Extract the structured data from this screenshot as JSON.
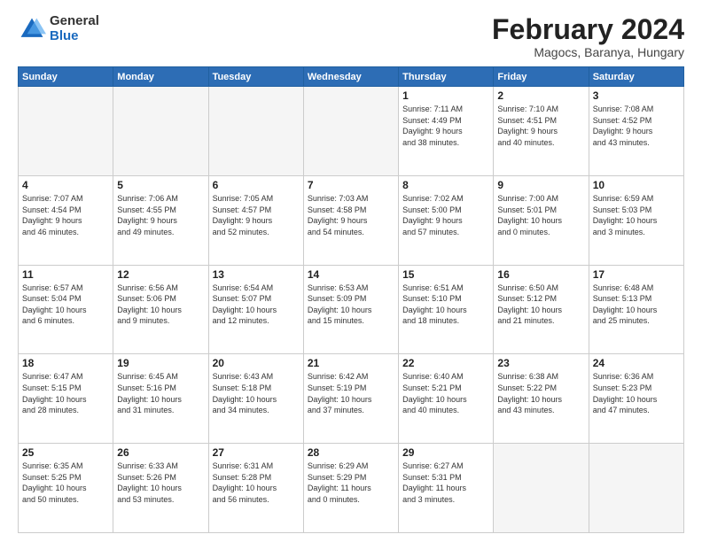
{
  "logo": {
    "general": "General",
    "blue": "Blue"
  },
  "header": {
    "title": "February 2024",
    "subtitle": "Magocs, Baranya, Hungary"
  },
  "columns": [
    "Sunday",
    "Monday",
    "Tuesday",
    "Wednesday",
    "Thursday",
    "Friday",
    "Saturday"
  ],
  "weeks": [
    [
      {
        "day": "",
        "info": ""
      },
      {
        "day": "",
        "info": ""
      },
      {
        "day": "",
        "info": ""
      },
      {
        "day": "",
        "info": ""
      },
      {
        "day": "1",
        "info": "Sunrise: 7:11 AM\nSunset: 4:49 PM\nDaylight: 9 hours\nand 38 minutes."
      },
      {
        "day": "2",
        "info": "Sunrise: 7:10 AM\nSunset: 4:51 PM\nDaylight: 9 hours\nand 40 minutes."
      },
      {
        "day": "3",
        "info": "Sunrise: 7:08 AM\nSunset: 4:52 PM\nDaylight: 9 hours\nand 43 minutes."
      }
    ],
    [
      {
        "day": "4",
        "info": "Sunrise: 7:07 AM\nSunset: 4:54 PM\nDaylight: 9 hours\nand 46 minutes."
      },
      {
        "day": "5",
        "info": "Sunrise: 7:06 AM\nSunset: 4:55 PM\nDaylight: 9 hours\nand 49 minutes."
      },
      {
        "day": "6",
        "info": "Sunrise: 7:05 AM\nSunset: 4:57 PM\nDaylight: 9 hours\nand 52 minutes."
      },
      {
        "day": "7",
        "info": "Sunrise: 7:03 AM\nSunset: 4:58 PM\nDaylight: 9 hours\nand 54 minutes."
      },
      {
        "day": "8",
        "info": "Sunrise: 7:02 AM\nSunset: 5:00 PM\nDaylight: 9 hours\nand 57 minutes."
      },
      {
        "day": "9",
        "info": "Sunrise: 7:00 AM\nSunset: 5:01 PM\nDaylight: 10 hours\nand 0 minutes."
      },
      {
        "day": "10",
        "info": "Sunrise: 6:59 AM\nSunset: 5:03 PM\nDaylight: 10 hours\nand 3 minutes."
      }
    ],
    [
      {
        "day": "11",
        "info": "Sunrise: 6:57 AM\nSunset: 5:04 PM\nDaylight: 10 hours\nand 6 minutes."
      },
      {
        "day": "12",
        "info": "Sunrise: 6:56 AM\nSunset: 5:06 PM\nDaylight: 10 hours\nand 9 minutes."
      },
      {
        "day": "13",
        "info": "Sunrise: 6:54 AM\nSunset: 5:07 PM\nDaylight: 10 hours\nand 12 minutes."
      },
      {
        "day": "14",
        "info": "Sunrise: 6:53 AM\nSunset: 5:09 PM\nDaylight: 10 hours\nand 15 minutes."
      },
      {
        "day": "15",
        "info": "Sunrise: 6:51 AM\nSunset: 5:10 PM\nDaylight: 10 hours\nand 18 minutes."
      },
      {
        "day": "16",
        "info": "Sunrise: 6:50 AM\nSunset: 5:12 PM\nDaylight: 10 hours\nand 21 minutes."
      },
      {
        "day": "17",
        "info": "Sunrise: 6:48 AM\nSunset: 5:13 PM\nDaylight: 10 hours\nand 25 minutes."
      }
    ],
    [
      {
        "day": "18",
        "info": "Sunrise: 6:47 AM\nSunset: 5:15 PM\nDaylight: 10 hours\nand 28 minutes."
      },
      {
        "day": "19",
        "info": "Sunrise: 6:45 AM\nSunset: 5:16 PM\nDaylight: 10 hours\nand 31 minutes."
      },
      {
        "day": "20",
        "info": "Sunrise: 6:43 AM\nSunset: 5:18 PM\nDaylight: 10 hours\nand 34 minutes."
      },
      {
        "day": "21",
        "info": "Sunrise: 6:42 AM\nSunset: 5:19 PM\nDaylight: 10 hours\nand 37 minutes."
      },
      {
        "day": "22",
        "info": "Sunrise: 6:40 AM\nSunset: 5:21 PM\nDaylight: 10 hours\nand 40 minutes."
      },
      {
        "day": "23",
        "info": "Sunrise: 6:38 AM\nSunset: 5:22 PM\nDaylight: 10 hours\nand 43 minutes."
      },
      {
        "day": "24",
        "info": "Sunrise: 6:36 AM\nSunset: 5:23 PM\nDaylight: 10 hours\nand 47 minutes."
      }
    ],
    [
      {
        "day": "25",
        "info": "Sunrise: 6:35 AM\nSunset: 5:25 PM\nDaylight: 10 hours\nand 50 minutes."
      },
      {
        "day": "26",
        "info": "Sunrise: 6:33 AM\nSunset: 5:26 PM\nDaylight: 10 hours\nand 53 minutes."
      },
      {
        "day": "27",
        "info": "Sunrise: 6:31 AM\nSunset: 5:28 PM\nDaylight: 10 hours\nand 56 minutes."
      },
      {
        "day": "28",
        "info": "Sunrise: 6:29 AM\nSunset: 5:29 PM\nDaylight: 11 hours\nand 0 minutes."
      },
      {
        "day": "29",
        "info": "Sunrise: 6:27 AM\nSunset: 5:31 PM\nDaylight: 11 hours\nand 3 minutes."
      },
      {
        "day": "",
        "info": ""
      },
      {
        "day": "",
        "info": ""
      }
    ]
  ]
}
